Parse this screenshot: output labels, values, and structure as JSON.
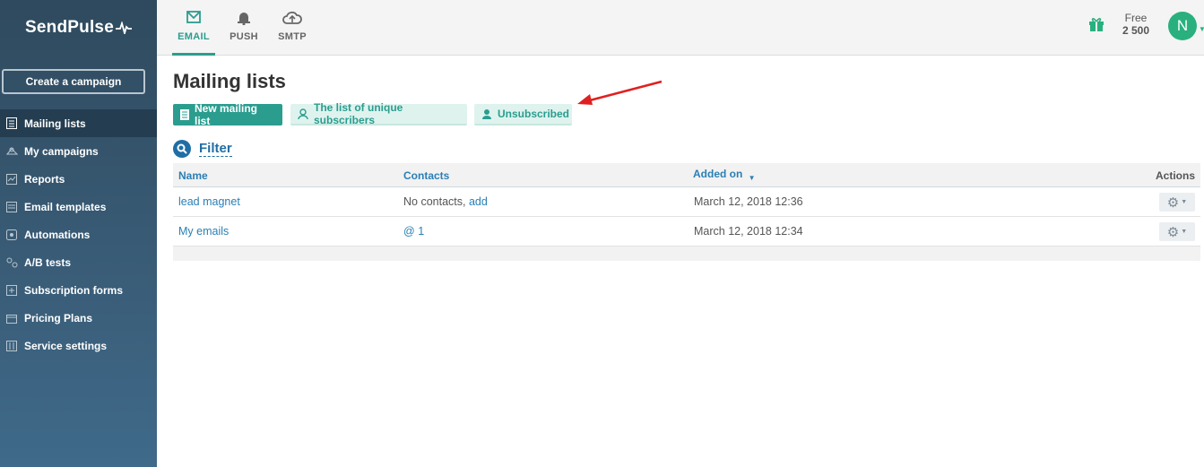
{
  "app": {
    "logo_text": "SendPulse"
  },
  "sidebar": {
    "create_label": "Create a campaign",
    "items": [
      {
        "label": "Mailing lists",
        "icon": "list-icon",
        "active": true
      },
      {
        "label": "My campaigns",
        "icon": "campaign-icon"
      },
      {
        "label": "Reports",
        "icon": "chart-icon"
      },
      {
        "label": "Email templates",
        "icon": "template-icon"
      },
      {
        "label": "Automations",
        "icon": "automation-icon"
      },
      {
        "label": "A/B tests",
        "icon": "ab-test-icon"
      },
      {
        "label": "Subscription forms",
        "icon": "form-icon"
      },
      {
        "label": "Pricing Plans",
        "icon": "wallet-icon"
      },
      {
        "label": "Service settings",
        "icon": "settings-icon"
      }
    ]
  },
  "topbar": {
    "tabs": [
      {
        "label": "EMAIL",
        "icon": "envelope-icon",
        "active": true
      },
      {
        "label": "PUSH",
        "icon": "bell-icon"
      },
      {
        "label": "SMTP",
        "icon": "cloud-upload-icon"
      }
    ],
    "plan_label": "Free",
    "plan_count": "2 500",
    "avatar_initial": "N"
  },
  "main": {
    "title": "Mailing lists",
    "buttons": {
      "new_list": "New mailing list",
      "unique": "The list of unique subscribers",
      "unsubscribed": "Unsubscribed"
    },
    "filter_label": "Filter",
    "table": {
      "headers": {
        "name": "Name",
        "contacts": "Contacts",
        "added": "Added on",
        "actions": "Actions"
      },
      "rows": [
        {
          "name": "lead magnet",
          "contacts_text": "No contacts,",
          "contacts_link": "add",
          "added": "March 12, 2018 12:36"
        },
        {
          "name": "My emails",
          "contacts_text": "@",
          "contacts_link": "1",
          "added": "March 12, 2018 12:34"
        }
      ]
    }
  },
  "colors": {
    "accent": "#2a9d8f",
    "link": "#2a7fb5",
    "sidebar": "#2f4a5e",
    "arrow": "#e02020"
  }
}
